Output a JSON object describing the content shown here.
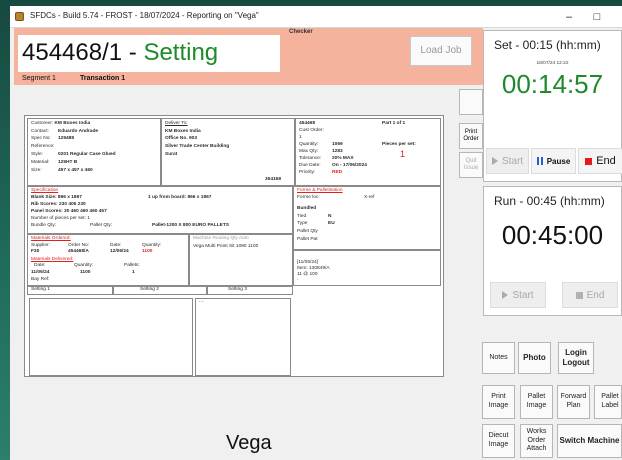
{
  "window": {
    "title": "SFDCs - Build 5.74 - FROST - 18/07/2024 - Reporting on \"Vega\"",
    "minimize_glyph": "–",
    "maximize_glyph": "□"
  },
  "header": {
    "checker_label": "Checker",
    "job_number": "454468/1",
    "job_separator": " - ",
    "job_status": "Setting",
    "segment": "Segment 1",
    "transaction": "Transaction 1",
    "load_job_label": "Load Job"
  },
  "side_buttons": {
    "print_order": "Print Order",
    "quit_issue": "Quit Issue"
  },
  "job_card": {
    "customer": {
      "label": "Customer:",
      "value": "KM Boxes India"
    },
    "contact": {
      "label": "Contact:",
      "value": "Eduardo Andrade"
    },
    "spec_no": {
      "label": "Spec No:",
      "value": "129488"
    },
    "reference": {
      "label": "Reference:",
      "value": ""
    },
    "style": {
      "label": "Style:",
      "value": "0201 Regular Case Glued"
    },
    "material": {
      "label": "Material:",
      "value": "125HT B"
    },
    "size": {
      "label": "Size:",
      "value": "457 x 457 x 460",
      "code": "354168"
    },
    "deliver_to": {
      "label": "Deliver To:",
      "lines": [
        "KM Boxes India",
        "Office No. 903",
        "Silver Trade Center Building",
        "Surat"
      ]
    },
    "order": {
      "number": "454468",
      "part": "Part 1 of 1",
      "cust_order_label": "Cust Order:",
      "cust_order_value": "1",
      "quantity_label": "Quantity:",
      "quantity_value": "1069",
      "max_qty_label": "Max Qty:",
      "max_qty_value": "1283",
      "tolerance_label": "Tolerance:",
      "tolerance_value": "20% MAX",
      "due_date_label": "Due Date:",
      "due_date_value": "On - 17/06/2024",
      "priority_label": "Priority:",
      "priority_value": "RED",
      "pieces_label": "Pieces per set:",
      "pieces_value": "1"
    },
    "specification": {
      "title": "Specification",
      "blank_size": "Blank Size:   866 x 1867",
      "up_from_board": "1 up from board: 866 x 1867",
      "rib_scores": "Rib Scores:   230   406   230",
      "panel_scores": "Panel Scores:  30   460   460   460   457",
      "pieces_per_blank": "Number of pieces per set:  1",
      "bundle_qty": "Bundle Qty:",
      "pallet_qty": "Pallet Qty:",
      "pallet_type": "Pallet-1200 X 800 EURO PALLETS"
    },
    "forme": {
      "title": "Forme & Palletisation",
      "forme_loc": "Forme loc:",
      "x_ref": "X-ref",
      "bundled": "Bundled",
      "tied": "Tied",
      "tied_value": "N",
      "type": "Type",
      "type_value": "EU",
      "pallet_qty": "Pallet Qty",
      "pallet_pat": "Pallet Pat"
    },
    "materials_ordered": {
      "title": "Materials Ordered:",
      "supplier_label": "Supplier:",
      "supplier_value": "F30",
      "order_no_label": "Order No:",
      "order_no_value": "454468/A",
      "date_label": "Date:",
      "date_value": "12/06/24",
      "quantity_label": "Quantity:",
      "quantity_value": "1100"
    },
    "materials_delivered": {
      "title": "Materials Delivered:",
      "date_label": "Date:",
      "date_value": "11/06/24",
      "quantity_label": "Quantity:",
      "quantity_value": "1100",
      "pallets_label": "Pallets:",
      "pallets_value": "1",
      "bay_ref_label": "Bay Ref:"
    },
    "machine_route": {
      "title": "Machine Routing Qty Auto",
      "line": "Vega Multi Point Sit 1080   1100"
    },
    "notes": {
      "lines": [
        "[11/05/24]",
        "Item: 130849/A",
        "11 @ 100",
        "-"
      ]
    },
    "settings": [
      "Setting 1",
      "Setting 2",
      "Setting 3"
    ],
    "note_box_glyph": "- -"
  },
  "machine_name": "Vega",
  "set_panel": {
    "title": "Set - 00:15 (hh:mm)",
    "timestamp": "18/07/24 12:22",
    "timer": "00:14:57",
    "timer_color": "#1e8a2a",
    "start_label": "Start",
    "pause_label": "Pause",
    "end_label": "End"
  },
  "run_panel": {
    "title": "Run - 00:45 (hh:mm)",
    "timer": "00:45:00",
    "start_label": "Start",
    "end_label": "End"
  },
  "action_buttons": {
    "notes": "Notes",
    "photo": "Photo",
    "login_logout": "Login Logout",
    "print_image": "Print Image",
    "pallet_image": "Pallet Image",
    "forward_plan": "Forward Plan",
    "pallet_label": "Pallet Label",
    "diecut_image": "Diecut Image",
    "works_order_attach": "Works Order Attach",
    "switch_machine": "Switch Machine"
  }
}
